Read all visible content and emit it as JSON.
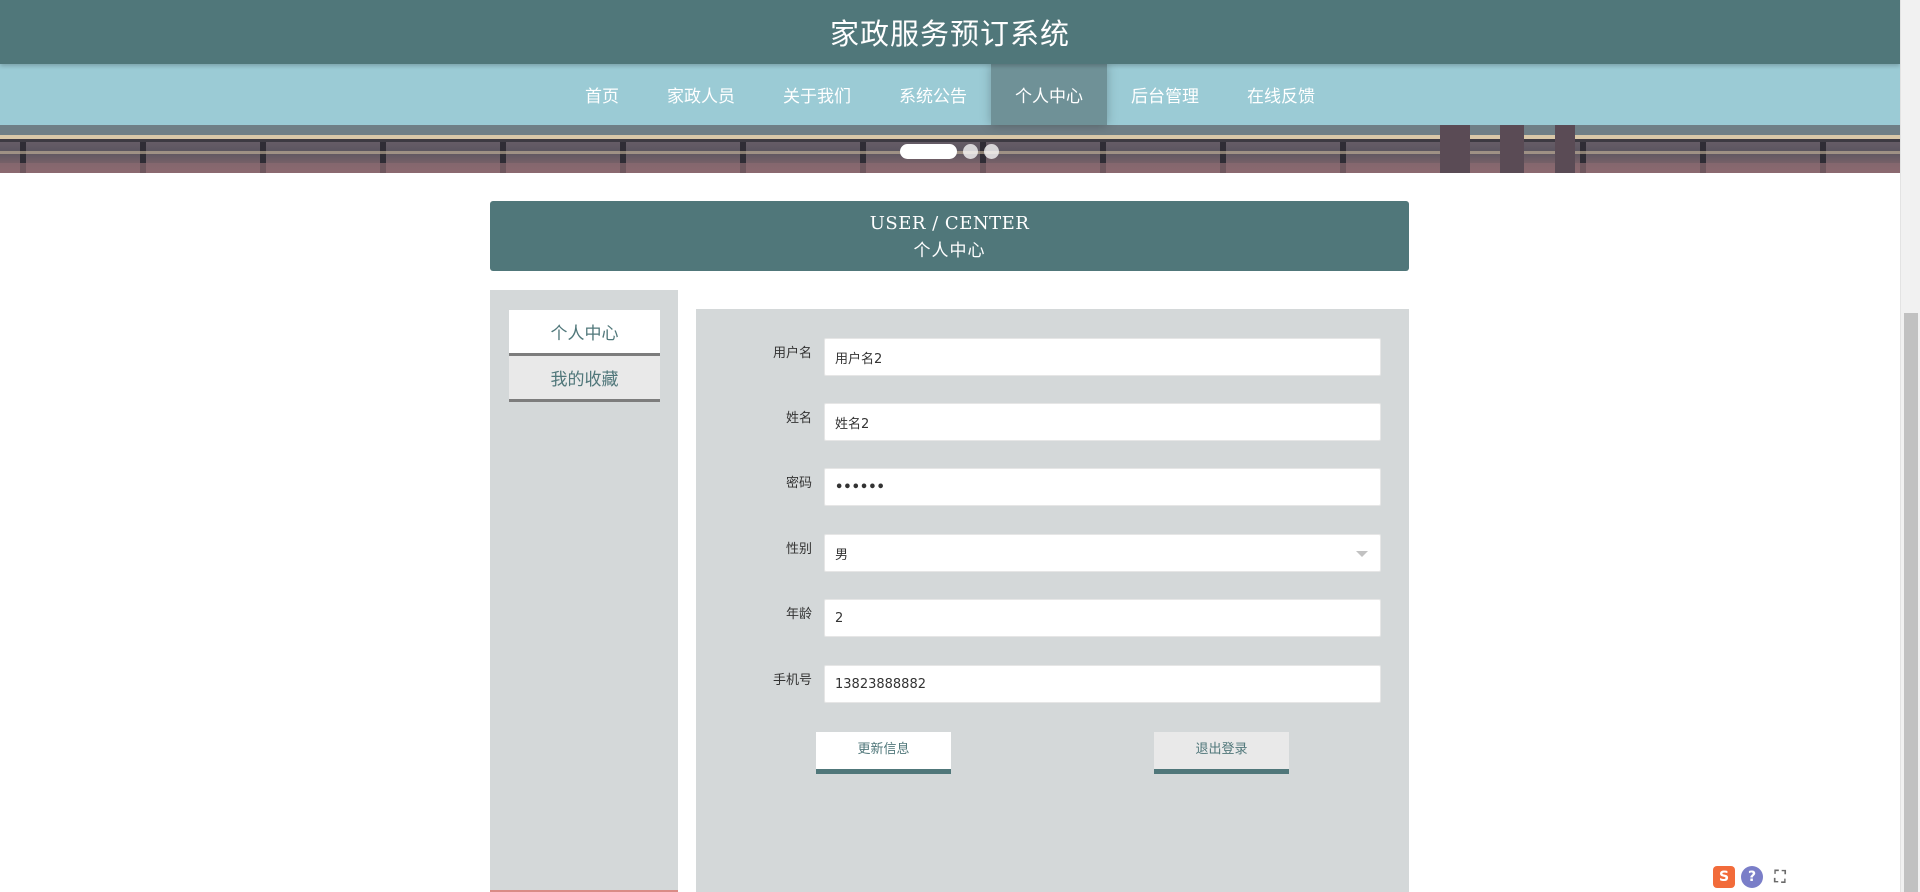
{
  "header": {
    "site_title": "家政服务预订系统"
  },
  "nav": {
    "items": [
      {
        "label": "首页",
        "active": false
      },
      {
        "label": "家政人员",
        "active": false
      },
      {
        "label": "关于我们",
        "active": false
      },
      {
        "label": "系统公告",
        "active": false
      },
      {
        "label": "个人中心",
        "active": true
      },
      {
        "label": "后台管理",
        "active": false
      },
      {
        "label": "在线反馈",
        "active": false
      }
    ]
  },
  "banner": {
    "slide_count": 3,
    "active_slide": 1
  },
  "section": {
    "title_en": "USER / CENTER",
    "title_cn": "个人中心"
  },
  "sidebar": {
    "items": [
      {
        "label": "个人中心",
        "active": true
      },
      {
        "label": "我的收藏",
        "active": false
      }
    ]
  },
  "form": {
    "username": {
      "label": "用户名",
      "value": "用户名2"
    },
    "name": {
      "label": "姓名",
      "value": "姓名2"
    },
    "password": {
      "label": "密码",
      "value": "••••••"
    },
    "gender": {
      "label": "性别",
      "value": "男"
    },
    "age": {
      "label": "年龄",
      "value": "2"
    },
    "phone": {
      "label": "手机号",
      "value": "13823888882"
    },
    "update_button": "更新信息",
    "logout_button": "退出登录"
  },
  "colors": {
    "header_bg": "#50777a",
    "nav_bg": "#9bcbd5",
    "panel_bg": "#d4d8d9",
    "accent": "#50777a"
  }
}
